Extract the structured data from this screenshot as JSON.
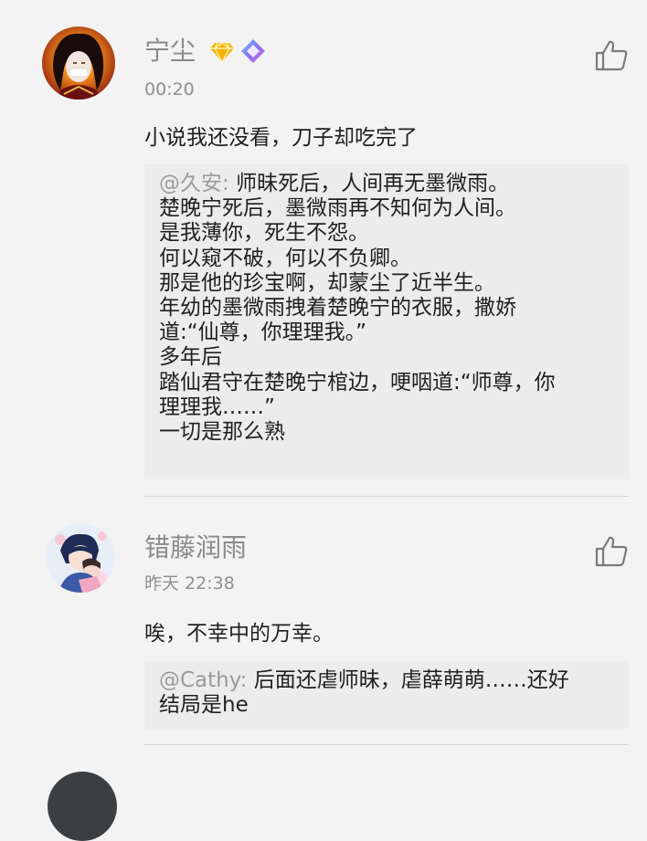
{
  "comments": [
    {
      "username": "宁尘",
      "badges": [
        "diamond-badge",
        "gem-badge"
      ],
      "timestamp": "00:20",
      "text": "小说我还没看，刀子却吃完了",
      "quote": {
        "user": "@久安:",
        "lines": [
          "师昧死后，人间再无墨微雨。",
          "楚晚宁死后，墨微雨再不知何为人间。",
          "是我薄你，死生不怨。",
          "何以窥不破，何以不负卿。",
          "那是他的珍宝啊，却蒙尘了近半生。",
          "年幼的墨微雨拽着楚晚宁的衣服，撒娇",
          "道:“仙尊，你理理我。”",
          "多年后",
          "踏仙君守在楚晚宁棺边，哽咽道:“师尊，你",
          "理理我……”",
          "一切是那么熟"
        ]
      }
    },
    {
      "username": "错藤润雨",
      "timestamp": "昨天 22:38",
      "text": "唉，不幸中的万幸。",
      "quote": {
        "user": "@Cathy:",
        "lines": [
          "后面还虐师昧，虐薛萌萌……还好",
          "结局是he"
        ]
      }
    }
  ],
  "colors": {
    "background": "#f3f3f3",
    "quote_background": "#ececec",
    "username": "#8a8a8a",
    "badge_gold": "#f5b400",
    "badge_purple": "#8a6cf0"
  }
}
